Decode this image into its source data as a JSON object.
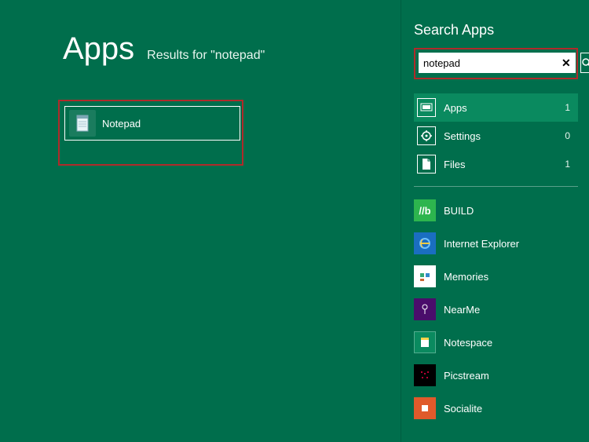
{
  "main": {
    "title": "Apps",
    "resultsLabel": "Results for \"notepad\"",
    "result": {
      "label": "Notepad"
    }
  },
  "panel": {
    "title": "Search Apps",
    "searchValue": "notepad",
    "scopes": [
      {
        "label": "Apps",
        "count": "1",
        "selected": true
      },
      {
        "label": "Settings",
        "count": "0",
        "selected": false
      },
      {
        "label": "Files",
        "count": "1",
        "selected": false
      }
    ],
    "apps": [
      {
        "label": "BUILD"
      },
      {
        "label": "Internet Explorer"
      },
      {
        "label": "Memories"
      },
      {
        "label": "NearMe"
      },
      {
        "label": "Notespace"
      },
      {
        "label": "Picstream"
      },
      {
        "label": "Socialite"
      }
    ]
  }
}
